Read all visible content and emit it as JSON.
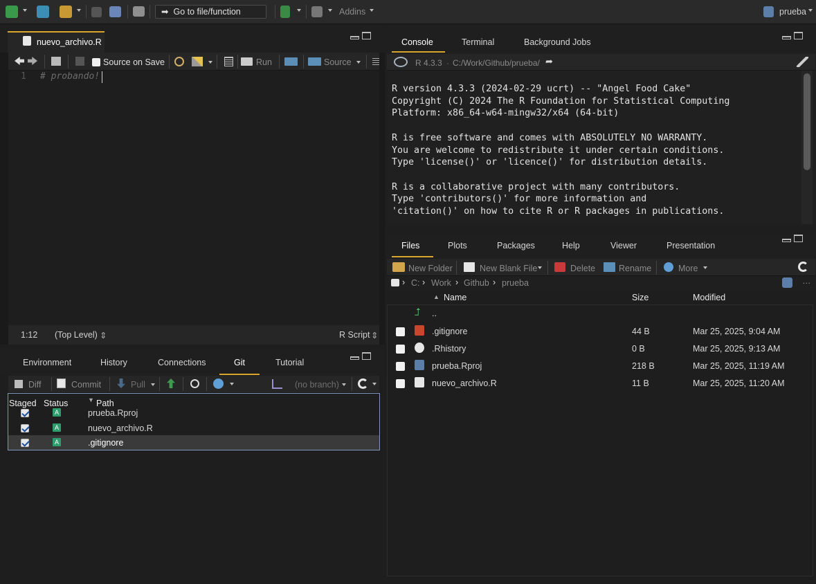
{
  "toolbar": {
    "goto_label": "Go to file/function",
    "addins_label": "Addins",
    "project_label": "prueba"
  },
  "editor": {
    "tab_label": "nuevo_archivo.R",
    "source_on_save_label": "Source on Save",
    "source_on_save_checked": false,
    "run_label": "Run",
    "source_label": "Source",
    "line_number": "1",
    "code": "# probando!",
    "status_position": "1:12",
    "status_scope": "(Top Level)",
    "status_filetype": "R Script"
  },
  "console_pane": {
    "tabs": [
      "Console",
      "Terminal",
      "Background Jobs"
    ],
    "active_tab": "Console",
    "r_version": "R 4.3.3",
    "path": "C:/Work/Github/prueba/",
    "lines": [
      "R version 4.3.3 (2024-02-29 ucrt) -- \"Angel Food Cake\"",
      "Copyright (C) 2024 The R Foundation for Statistical Computing",
      "Platform: x86_64-w64-mingw32/x64 (64-bit)",
      "",
      "R is free software and comes with ABSOLUTELY NO WARRANTY.",
      "You are welcome to redistribute it under certain conditions.",
      "Type 'license()' or 'licence()' for distribution details.",
      "",
      "R is a collaborative project with many contributors.",
      "Type 'contributors()' for more information and",
      "'citation()' on how to cite R or R packages in publications."
    ]
  },
  "env_pane": {
    "tabs": [
      "Environment",
      "History",
      "Connections",
      "Git",
      "Tutorial"
    ],
    "active_tab": "Git",
    "diff_label": "Diff",
    "commit_label": "Commit",
    "pull_label": "Pull",
    "branch_label": "(no branch)",
    "columns": [
      "Staged",
      "Status",
      "Path"
    ],
    "rows": [
      {
        "staged": true,
        "status": "A",
        "path": "prueba.Rproj"
      },
      {
        "staged": true,
        "status": "A",
        "path": "nuevo_archivo.R"
      },
      {
        "staged": true,
        "status": "A",
        "path": ".gitignore"
      }
    ]
  },
  "files_pane": {
    "tabs": [
      "Files",
      "Plots",
      "Packages",
      "Help",
      "Viewer",
      "Presentation"
    ],
    "active_tab": "Files",
    "new_folder_label": "New Folder",
    "new_blank_file_label": "New Blank File",
    "delete_label": "Delete",
    "rename_label": "Rename",
    "more_label": "More",
    "breadcrumb": [
      "C:",
      "Work",
      "Github",
      "prueba"
    ],
    "columns": [
      "Name",
      "Size",
      "Modified"
    ],
    "up_label": "..",
    "rows": [
      {
        "name": ".gitignore",
        "size": "44 B",
        "modified": "Mar 25, 2025, 9:04 AM"
      },
      {
        "name": ".Rhistory",
        "size": "0 B",
        "modified": "Mar 25, 2025, 9:13 AM"
      },
      {
        "name": "prueba.Rproj",
        "size": "218 B",
        "modified": "Mar 25, 2025, 11:19 AM"
      },
      {
        "name": "nuevo_archivo.R",
        "size": "11 B",
        "modified": "Mar 25, 2025, 11:20 AM"
      }
    ]
  },
  "colors": {
    "accent_tab": "#d9a52b",
    "git_added": "#2f9e6e",
    "selection_border": "#7f95b8"
  }
}
